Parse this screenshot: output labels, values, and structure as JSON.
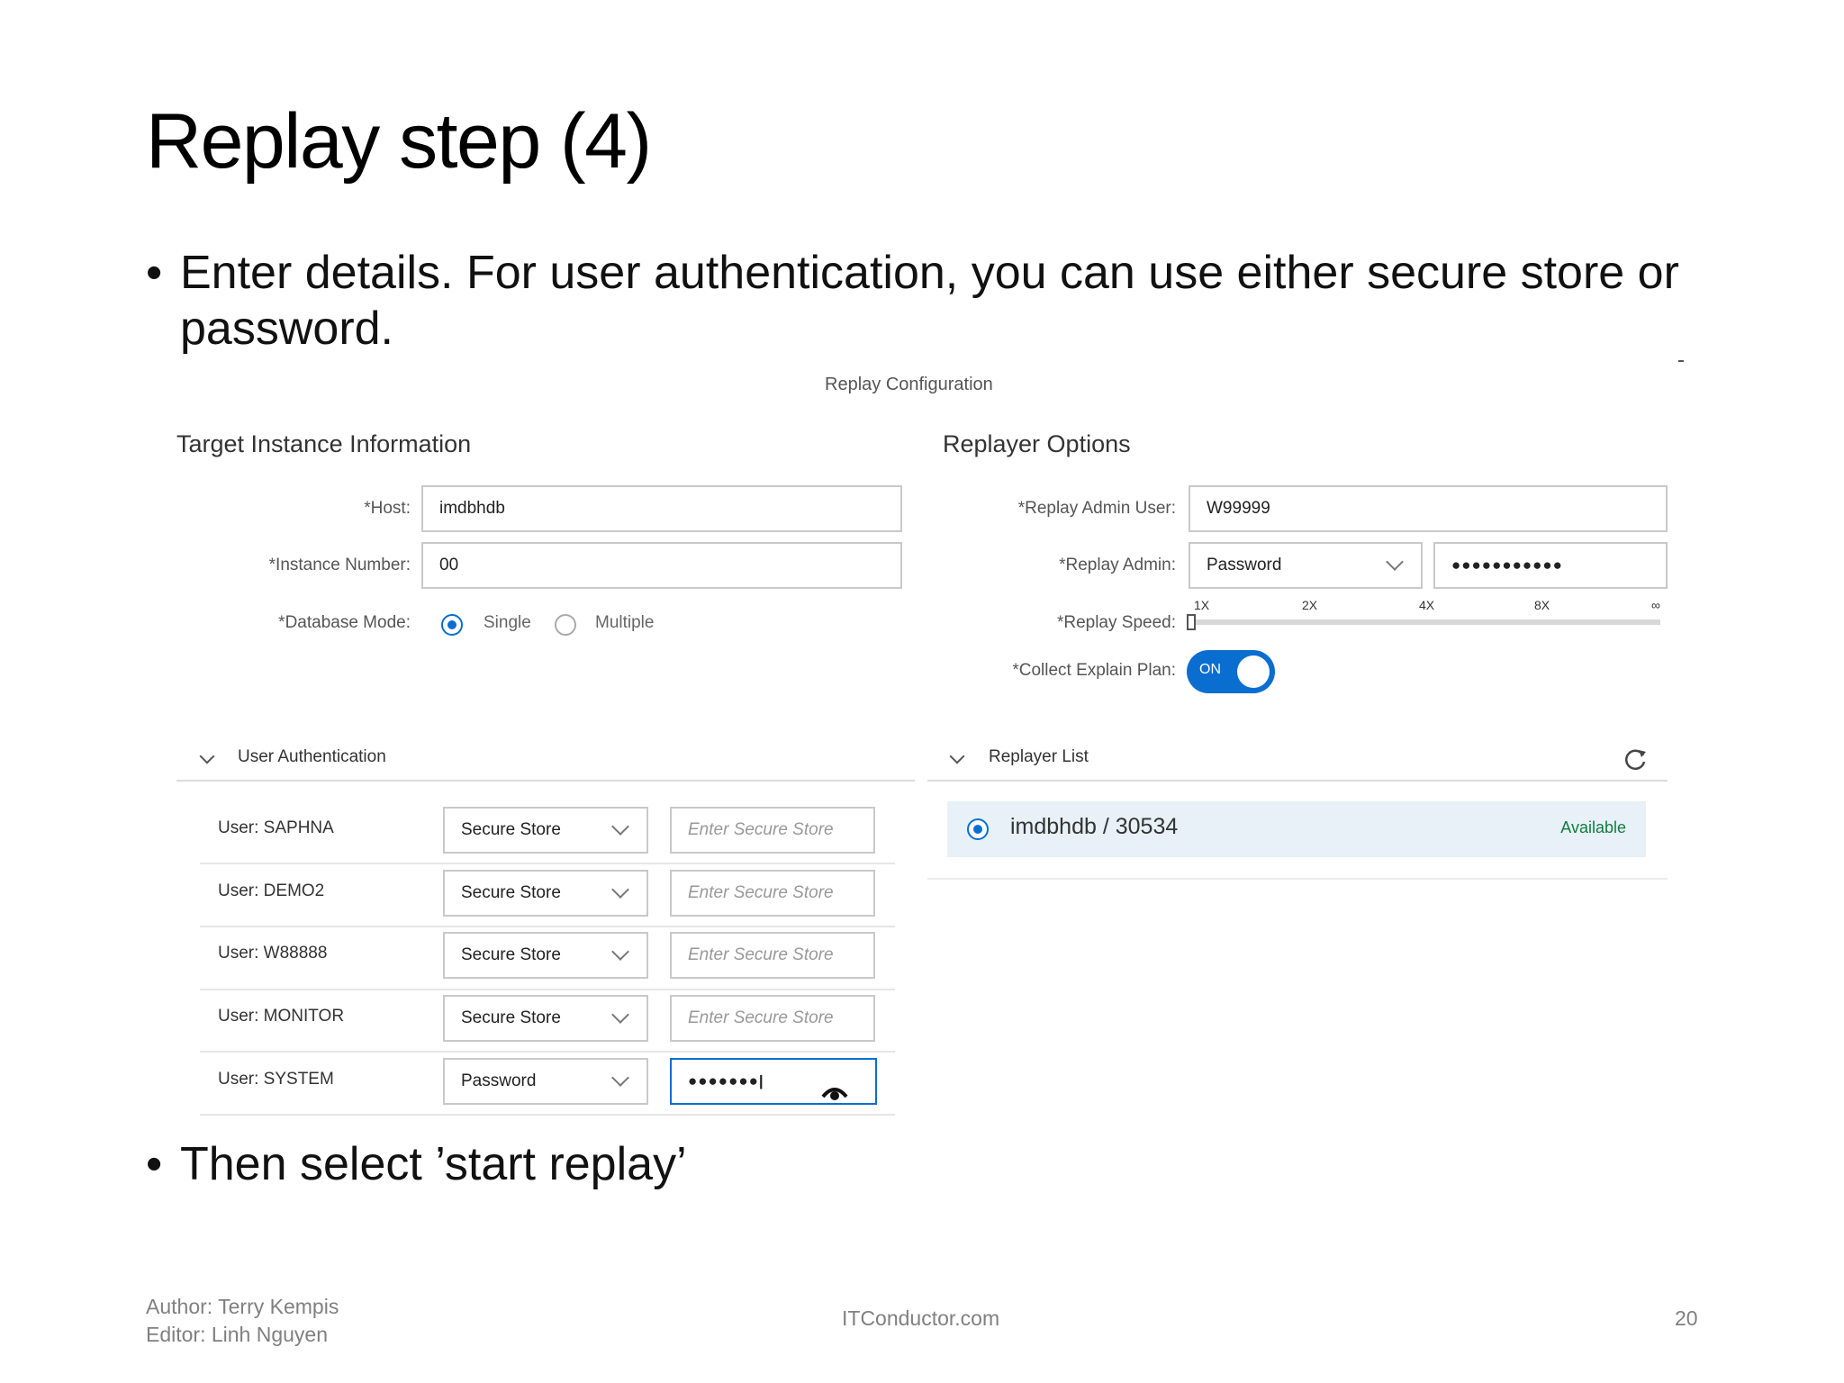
{
  "slide": {
    "title": "Replay step (4)",
    "bullet_char": "•",
    "bullets": [
      "Enter details. For user authentication, you can use either secure store or password.",
      "Then select ’start replay’"
    ],
    "footer": {
      "author": "Author: Terry Kempis",
      "editor": "Editor: Linh Nguyen",
      "site": "ITConductor.com",
      "page": "20"
    }
  },
  "ui": {
    "title": "Replay Configuration",
    "target": {
      "heading": "Target Instance Information",
      "host_label": "*Host:",
      "host_value": "imdbhdb",
      "instance_label": "*Instance Number:",
      "instance_value": "00",
      "mode_label": "*Database Mode:",
      "mode_options": [
        "Single",
        "Multiple"
      ],
      "mode_selected": "Single"
    },
    "replayer": {
      "heading": "Replayer Options",
      "admin_user_label": "*Replay Admin User:",
      "admin_user_value": "W99999",
      "admin_label": "*Replay Admin:",
      "admin_type": "Password",
      "admin_password_mask": "●●●●●●●●●●●",
      "speed_label": "*Replay Speed:",
      "speed_ticks": [
        "1X",
        "2X",
        "4X",
        "8X",
        "∞"
      ],
      "speed_value": "1X",
      "explain_label": "*Collect Explain Plan:",
      "explain_state": "ON"
    },
    "auth": {
      "heading": "User Authentication",
      "users": [
        {
          "label": "User: SAPHNA",
          "method": "Secure Store",
          "input": "Enter Secure Store",
          "is_password": false
        },
        {
          "label": "User: DEMO2",
          "method": "Secure Store",
          "input": "Enter Secure Store",
          "is_password": false
        },
        {
          "label": "User: W88888",
          "method": "Secure Store",
          "input": "Enter Secure Store",
          "is_password": false
        },
        {
          "label": "User: MONITOR",
          "method": "Secure Store",
          "input": "Enter Secure Store",
          "is_password": false
        },
        {
          "label": "User: SYSTEM",
          "method": "Password",
          "input": "●●●●●●●|",
          "is_password": true
        }
      ]
    },
    "replayer_list": {
      "heading": "Replayer List",
      "items": [
        {
          "name": "imdbhdb / 30534",
          "status": "Available",
          "selected": true
        }
      ]
    }
  },
  "colors": {
    "accent": "#0a6ed1",
    "available": "#107e3e",
    "selected_row": "#e7f1f7"
  }
}
